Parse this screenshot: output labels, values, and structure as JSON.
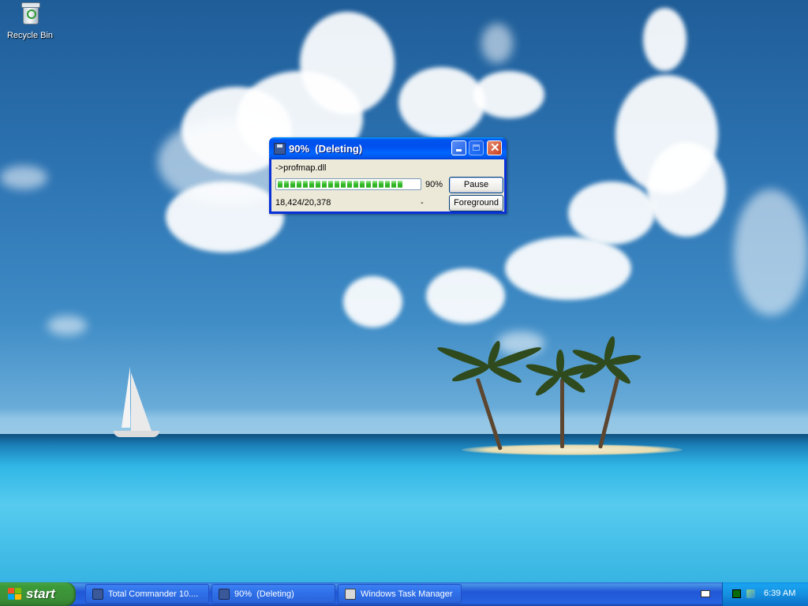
{
  "desktop": {
    "icons": [
      {
        "label": "Recycle Bin",
        "icon": "recycle-bin-icon"
      }
    ]
  },
  "dialog": {
    "title": "90%  (Deleting)",
    "icon": "floppy-disk-icon",
    "file": "->profmap.dll",
    "progress_percent": 90,
    "progress_label": "90%",
    "count": "18,424/20,378",
    "dash": "-",
    "pause_label": "Pause",
    "foreground_label": "Foreground"
  },
  "taskbar": {
    "start_label": "start",
    "tasks": [
      {
        "label": "Total Commander 10....",
        "icon": "floppy-disk-icon",
        "active": false
      },
      {
        "label": "90%  (Deleting)",
        "icon": "floppy-disk-icon",
        "active": false
      },
      {
        "label": "Windows Task Manager",
        "icon": "task-manager-icon",
        "active": false
      }
    ],
    "tray": {
      "icons": [
        "keyboard-icon",
        "cpu-usage-icon",
        "network-icon"
      ],
      "clock": "6:39 AM"
    }
  },
  "colors": {
    "titlebar_blue": "#0054e3",
    "start_green": "#3c9b38",
    "progress_green": "#37c12b",
    "dialog_face": "#ece9d8"
  }
}
